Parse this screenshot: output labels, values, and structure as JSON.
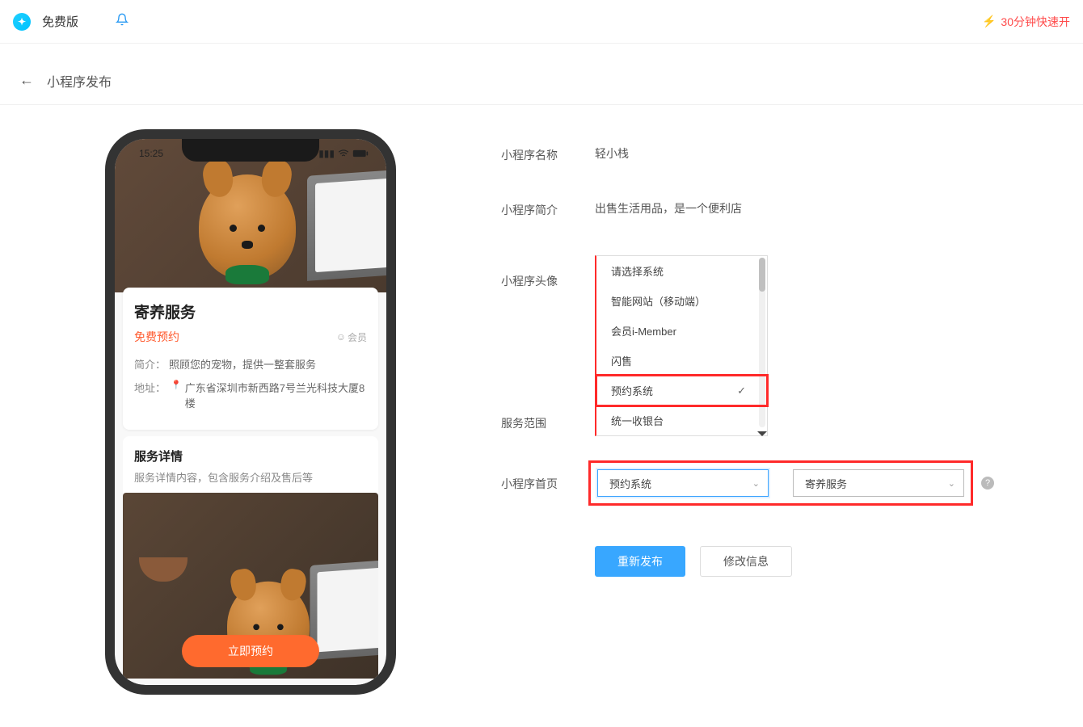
{
  "top": {
    "version_label": "免费版",
    "quick_text": "30分钟快速开",
    "status_time": "15:25"
  },
  "header": {
    "title": "小程序发布"
  },
  "preview": {
    "card_title": "寄养服务",
    "price": "免费预约",
    "member": "会员",
    "intro_label": "简介：",
    "intro_text": "照顾您的宠物，提供一整套服务",
    "addr_label": "地址：",
    "addr_text": "广东省深圳市新西路7号兰光科技大厦8楼",
    "detail_title": "服务详情",
    "detail_sub": "服务详情内容，包含服务介绍及售后等",
    "book_btn": "立即预约"
  },
  "form": {
    "name_label": "小程序名称",
    "name_value": "轻小栈",
    "intro_label": "小程序简介",
    "intro_value": "出售生活用品，是一个便利店",
    "avatar_label": "小程序头像",
    "scope_label": "服务范围",
    "homepage_label": "小程序首页",
    "dropdown": {
      "items": [
        "请选择系统",
        "智能网站（移动端）",
        "会员i-Member",
        "闪售",
        "预约系统",
        "统一收银台"
      ],
      "selected_index": 4
    },
    "homepage_select_1": "预约系统",
    "homepage_select_2": "寄养服务",
    "btn_republish": "重新发布",
    "btn_edit": "修改信息"
  }
}
